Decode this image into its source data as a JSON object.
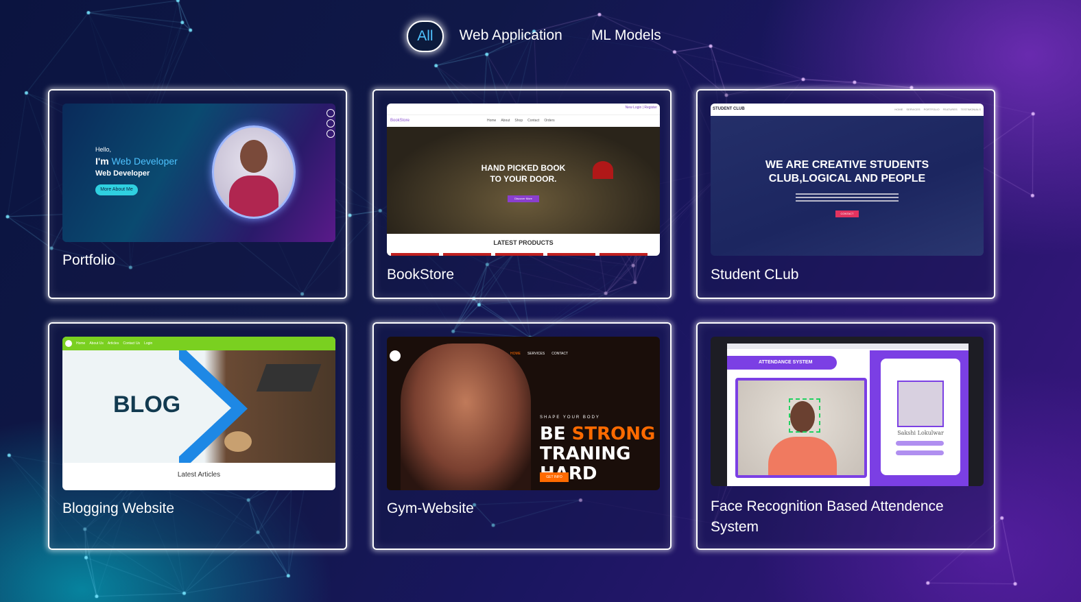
{
  "filters": {
    "all": "All",
    "web": "Web Application",
    "ml": "ML Models"
  },
  "colors": {
    "accent": "#4fc3ff",
    "card_border": "#ffffff",
    "club_btn": "#e2335f",
    "gym_orange": "#ff6a00",
    "face_purple": "#7b3fe4"
  },
  "projects": [
    {
      "title": "Portfolio",
      "thumb": {
        "hello": "Hello,",
        "im": "I'm",
        "role_typed": "Web Developer",
        "role": "Web Developer",
        "button": "More About Me"
      }
    },
    {
      "title": "BookStore",
      "thumb": {
        "brand": "BookStore",
        "nav": [
          "Home",
          "About",
          "Shop",
          "Contact",
          "Orders"
        ],
        "login": "New Login | Register",
        "headline1": "HAND PICKED BOOK",
        "headline2": "TO YOUR DOOR.",
        "button": "Discover More",
        "section": "LATEST PRODUCTS"
      }
    },
    {
      "title": "Student CLub",
      "thumb": {
        "brand": "STUDENT CLUB",
        "nav": [
          "HOME",
          "SERVICES",
          "PORTFOLIO",
          "FEATURES",
          "TESTIMONIALS"
        ],
        "headline1": "WE ARE CREATIVE STUDENTS",
        "headline2": "CLUB,LOGICAL AND PEOPLE",
        "button": "CONTACT"
      }
    },
    {
      "title": "Blogging Website",
      "thumb": {
        "nav": [
          "Home",
          "About Us",
          "Articles",
          "Contact Us",
          "Login"
        ],
        "hero": "BLOG",
        "section": "Latest Articles"
      }
    },
    {
      "title": "Gym-Website",
      "thumb": {
        "nav": [
          "HOME",
          "SERVICES",
          "CONTACT"
        ],
        "tagline": "SHAPE YOUR BODY",
        "headline_white": "BE",
        "headline_orange": "STRONG",
        "headline2": "TRANING HARD",
        "button": "GET INFO"
      }
    },
    {
      "title": "Face Recognition Based Attendence System",
      "thumb": {
        "header": "ATTENDANCE SYSTEM",
        "name": "Sakshi Lokulwar"
      }
    }
  ]
}
